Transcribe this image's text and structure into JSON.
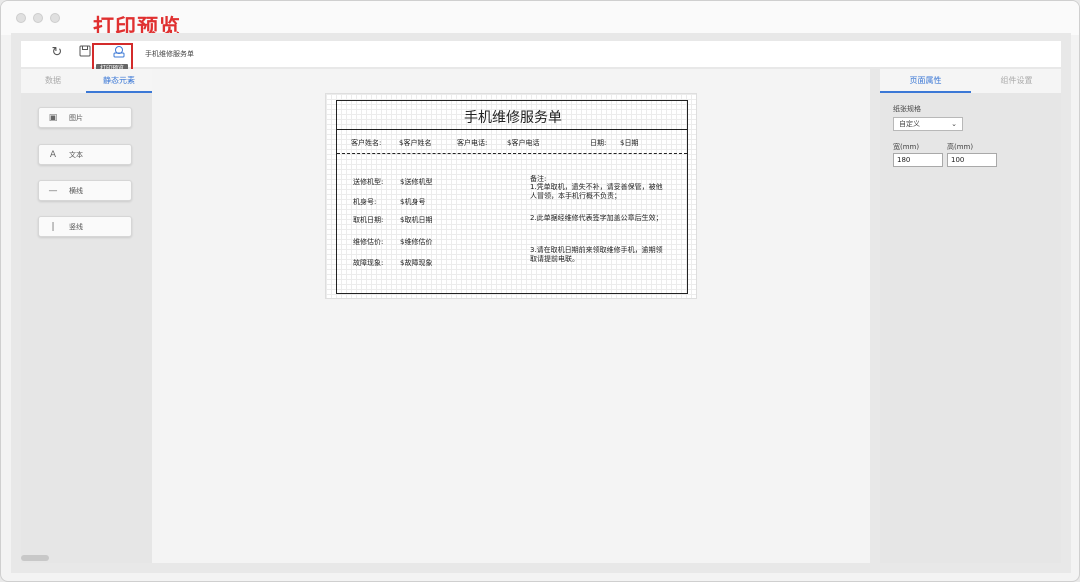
{
  "annotation_title": "打印预览",
  "toolbar": {
    "refresh_icon": "refresh-icon",
    "save_icon": "save-icon",
    "print_preview_icon": "print-preview-icon",
    "tooltip": "打印预览",
    "document_name": "手机维修服务单"
  },
  "left_panel": {
    "tabs": [
      "数据",
      "静态元素"
    ],
    "elements": [
      {
        "label": "图片",
        "icon": "image-icon"
      },
      {
        "label": "文本",
        "icon": "text-icon"
      },
      {
        "label": "横线",
        "icon": "horizontal-line-icon"
      },
      {
        "label": "竖线",
        "icon": "vertical-line-icon"
      }
    ]
  },
  "form": {
    "title": "手机维修服务单",
    "customer_name_label": "客户姓名:",
    "customer_name_value": "$客户姓名",
    "customer_phone_label": "客户电话:",
    "customer_phone_value": "$客户电话",
    "date_label": "日期:",
    "date_value": "$日期",
    "fields": [
      {
        "label": "送修机型:",
        "value": "$送修机型"
      },
      {
        "label": "机身号:",
        "value": "$机身号"
      },
      {
        "label": "取机日期:",
        "value": "$取机日期"
      },
      {
        "label": "维修估价:",
        "value": "$维修估价"
      },
      {
        "label": "故障现象:",
        "value": "$故障现象"
      }
    ],
    "notes_title": "备注:",
    "notes": [
      "1.凭单取机，遗失不补，请妥善保管，被他人冒领，本手机行概不负责；",
      "2.此单据经维修代表签字加盖公章后生效；",
      "3.请在取机日期前来领取维修手机，逾期领取请提前电联。"
    ]
  },
  "right_panel": {
    "tabs": [
      "页面属性",
      "组件设置"
    ],
    "paper_spec_label": "纸张规格",
    "paper_spec_value": "自定义",
    "width_label": "宽(mm)",
    "height_label": "高(mm)",
    "width_value": "180",
    "height_value": "100"
  },
  "colors": {
    "accent": "#3b78d6",
    "annotation": "#e03030"
  }
}
